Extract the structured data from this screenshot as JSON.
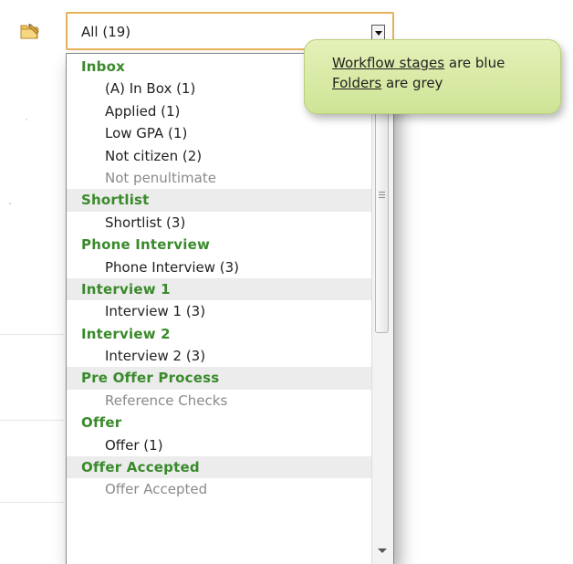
{
  "dropdown": {
    "selected": "All (19)"
  },
  "list": [
    {
      "type": "header",
      "label": "Inbox",
      "shaded": false
    },
    {
      "type": "item",
      "label": "(A) In Box (1)",
      "folder": false
    },
    {
      "type": "item",
      "label": "Applied (1)",
      "folder": false
    },
    {
      "type": "item",
      "label": "Low GPA (1)",
      "folder": false
    },
    {
      "type": "item",
      "label": "Not citizen (2)",
      "folder": false
    },
    {
      "type": "item",
      "label": "Not penultimate",
      "folder": true
    },
    {
      "type": "header",
      "label": "Shortlist",
      "shaded": true
    },
    {
      "type": "item",
      "label": "Shortlist (3)",
      "folder": false
    },
    {
      "type": "header",
      "label": "Phone Interview",
      "shaded": false
    },
    {
      "type": "item",
      "label": "Phone Interview (3)",
      "folder": false
    },
    {
      "type": "header",
      "label": "Interview 1",
      "shaded": true
    },
    {
      "type": "item",
      "label": "Interview 1 (3)",
      "folder": false
    },
    {
      "type": "header",
      "label": "Interview 2",
      "shaded": false
    },
    {
      "type": "item",
      "label": "Interview 2 (3)",
      "folder": false
    },
    {
      "type": "header",
      "label": "Pre Offer Process",
      "shaded": true
    },
    {
      "type": "item",
      "label": "Reference Checks",
      "folder": true
    },
    {
      "type": "header",
      "label": "Offer",
      "shaded": false
    },
    {
      "type": "item",
      "label": "Offer (1)",
      "folder": false
    },
    {
      "type": "header",
      "label": "Offer Accepted",
      "shaded": true
    },
    {
      "type": "item",
      "label": "Offer Accepted",
      "folder": true
    }
  ],
  "callout": {
    "line1_link": "Workflow stages",
    "line1_rest": " are blue",
    "line2_link": "Folders",
    "line2_rest": " are grey"
  },
  "colors": {
    "stage_header": "#3a8a2c",
    "folder_item": "#8a8a8a",
    "select_border": "#e7b15b",
    "callout_bg": "#d9eaa6"
  },
  "icons": {
    "folder": "folder-pencil-icon",
    "dropdown": "chevron-down-icon",
    "scroll_down": "scroll-down-arrow-icon"
  }
}
